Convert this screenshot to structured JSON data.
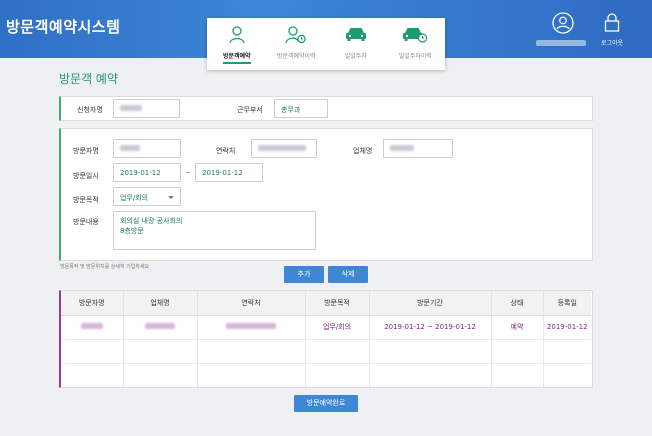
{
  "header": {
    "app_title": "방문객예약시스템",
    "nav": [
      {
        "label": "방문객예약",
        "icon": "person-icon",
        "active": true
      },
      {
        "label": "방문객예약이력",
        "icon": "person-history-icon",
        "active": false
      },
      {
        "label": "일일주차",
        "icon": "car-icon",
        "active": false
      },
      {
        "label": "일일주차이력",
        "icon": "car-history-icon",
        "active": false
      }
    ],
    "logout_label": "로그아웃"
  },
  "page_title": "방문객 예약",
  "applicant": {
    "name_label": "신청자명",
    "dept_label": "근무부서",
    "dept_value": "총무과"
  },
  "visit_form": {
    "visitor_name_label": "방문자명",
    "contact_label": "연락처",
    "company_label": "업체명",
    "date_label": "방문일시",
    "date_from": "2019-01-12",
    "date_sep": "~",
    "date_to": "2019-01-12",
    "purpose_label": "방문목적",
    "purpose_value": "업무/회의",
    "content_label": "방문내용",
    "content_line1": "회의실 내장 공사회의",
    "content_line2": "8층방문"
  },
  "hint": "방문목적 및 방문위치를 상세히 기입하세요",
  "buttons": {
    "add": "추가",
    "delete": "삭제",
    "complete": "방문예약완료"
  },
  "table": {
    "headers": [
      "방문자명",
      "업체명",
      "연락처",
      "방문목적",
      "방문기간",
      "상태",
      "등록일"
    ],
    "row": {
      "purpose": "업무/회의",
      "period": "2019-01-12 ~ 2019-01-12",
      "status": "예약",
      "registered": "2019-01-12"
    }
  },
  "colors": {
    "header_blue": "#3e86d6",
    "accent_green": "#1f9a6e",
    "row_purple": "#7d1f73"
  }
}
